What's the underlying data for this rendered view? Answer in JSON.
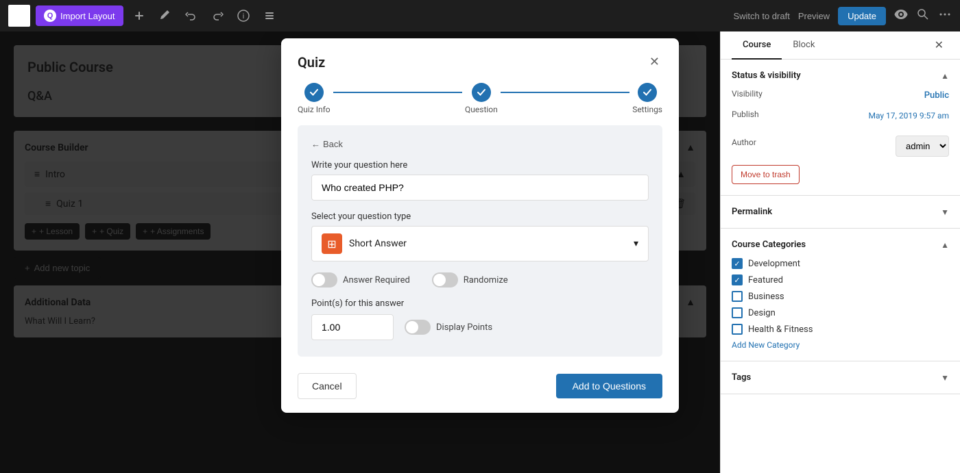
{
  "topbar": {
    "wp_logo": "W",
    "import_btn": "Import Layout",
    "switch_draft": "Switch to draft",
    "preview": "Preview",
    "update": "Update"
  },
  "content": {
    "public_course": "Public Course",
    "qa": "Q&A",
    "course_builder": "Course Builder",
    "intro": "Intro",
    "quiz1": "Quiz 1",
    "lesson_btn": "+ Lesson",
    "quiz_btn": "+ Quiz",
    "assignments_btn": "+ Assignments",
    "add_new_topic": "Add new topic",
    "additional_data": "Additional Data",
    "what_will": "What Will I Learn?"
  },
  "modal": {
    "title": "Quiz",
    "step1_label": "Quiz Info",
    "step2_label": "Question",
    "step3_label": "Settings",
    "back_btn": "Back",
    "question_label": "Write your question here",
    "question_placeholder": "Who created PHP?",
    "question_type_label": "Select your question type",
    "question_type": "Short Answer",
    "answer_required_label": "Answer Required",
    "randomize_label": "Randomize",
    "points_label": "Point(s) for this answer",
    "points_value": "1.00",
    "display_points_label": "Display Points",
    "cancel_btn": "Cancel",
    "add_questions_btn": "Add to Questions"
  },
  "right_panel": {
    "tab_course": "Course",
    "tab_block": "Block",
    "status_visibility_title": "Status & visibility",
    "visibility_label": "Visibility",
    "visibility_value": "Public",
    "publish_label": "Publish",
    "publish_value": "May 17, 2019 9:57 am",
    "author_label": "Author",
    "author_value": "admin",
    "move_to_trash": "Move to trash",
    "permalink_title": "Permalink",
    "categories_title": "Course Categories",
    "categories": [
      {
        "label": "Development",
        "checked": true
      },
      {
        "label": "Featured",
        "checked": true
      },
      {
        "label": "Business",
        "checked": false
      },
      {
        "label": "Design",
        "checked": false
      },
      {
        "label": "Health & Fitness",
        "checked": false
      }
    ],
    "add_new_category": "Add New Category",
    "tags_title": "Tags"
  }
}
